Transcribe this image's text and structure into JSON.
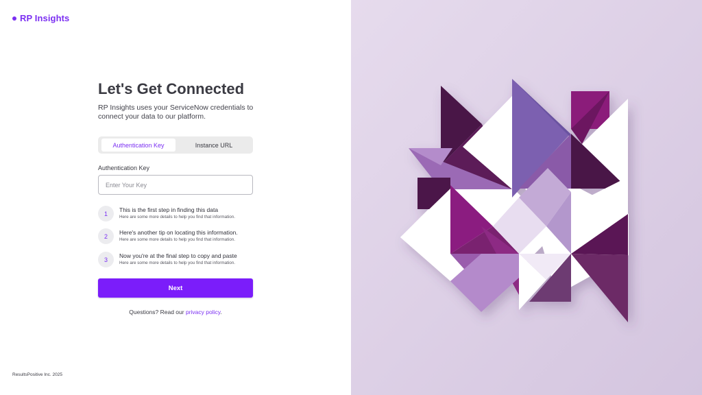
{
  "brand": {
    "name": "RP Insights",
    "accent": "#7b2ff2"
  },
  "heading": {
    "title": "Let's Get Connected",
    "subtitle": "RP Insights uses your ServiceNow credentials to connect your data to our platform."
  },
  "tabs": [
    {
      "label": "Authentication Key",
      "active": true
    },
    {
      "label": "Instance URL",
      "active": false
    }
  ],
  "form": {
    "field_label": "Authentication Key",
    "placeholder": "Enter Your Key",
    "value": ""
  },
  "steps": [
    {
      "number": "1",
      "title": "This is the first step in finding this data",
      "desc": "Here are some more details to help you find that information."
    },
    {
      "number": "2",
      "title": "Here's another tip on locating this information.",
      "desc": "Here are some more details to help you find that information."
    },
    {
      "number": "3",
      "title": "Now you're at the final step to copy and paste",
      "desc": "Here are some more details to help you find that information."
    }
  ],
  "next_label": "Next",
  "questions": {
    "prefix": "Questions? Read our ",
    "link": "privacy policy",
    "suffix": "."
  },
  "footer": "ResultsPositive Inc. 2025",
  "colors": {
    "primary_button": "#7b1dfa",
    "panel_bg": "#dcd0e5"
  }
}
